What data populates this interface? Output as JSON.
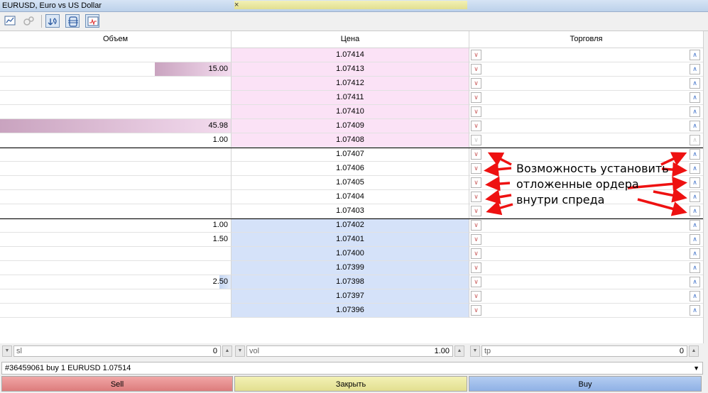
{
  "window": {
    "title": "EURUSD, Euro vs US Dollar",
    "close_glyph": "×"
  },
  "toolbar": {
    "buttons": [
      "chart-icon",
      "disabled-trade-icon",
      "scroll-to-price-icon",
      "center-spread-icon",
      "tick-chart-icon"
    ]
  },
  "columns": {
    "volume": "Объем",
    "price": "Цена",
    "trade": "Торговля"
  },
  "colors": {
    "ask_bg": "#fbe2f6",
    "bid_bg": "#d5e2f9",
    "ask_bar": "#c9a3bf",
    "bid_bar": "#c3d5f2",
    "sell": "#e28b8b",
    "close": "#e9e6a3",
    "buy": "#9fbdea",
    "arrow": "#ee1111"
  },
  "rows": [
    {
      "price": "1.07414",
      "volume": "",
      "side": "ask",
      "bar": 0
    },
    {
      "price": "1.07413",
      "volume": "15.00",
      "side": "ask",
      "bar": 0.33
    },
    {
      "price": "1.07412",
      "volume": "",
      "side": "ask",
      "bar": 0
    },
    {
      "price": "1.07411",
      "volume": "",
      "side": "ask",
      "bar": 0
    },
    {
      "price": "1.07410",
      "volume": "",
      "side": "ask",
      "bar": 0
    },
    {
      "price": "1.07409",
      "volume": "45.98",
      "side": "ask",
      "bar": 1
    },
    {
      "price": "1.07408",
      "volume": "1.00",
      "side": "ask",
      "bar": 0
    },
    {
      "price": "1.07407",
      "volume": "",
      "side": "spread",
      "bar": 0
    },
    {
      "price": "1.07406",
      "volume": "",
      "side": "spread",
      "bar": 0
    },
    {
      "price": "1.07405",
      "volume": "",
      "side": "spread",
      "bar": 0
    },
    {
      "price": "1.07404",
      "volume": "",
      "side": "spread",
      "bar": 0
    },
    {
      "price": "1.07403",
      "volume": "",
      "side": "spread",
      "bar": 0
    },
    {
      "price": "1.07402",
      "volume": "1.00",
      "side": "bid",
      "bar": 0
    },
    {
      "price": "1.07401",
      "volume": "1.50",
      "side": "bid",
      "bar": 0
    },
    {
      "price": "1.07400",
      "volume": "",
      "side": "bid",
      "bar": 0
    },
    {
      "price": "1.07399",
      "volume": "",
      "side": "bid",
      "bar": 0
    },
    {
      "price": "1.07398",
      "volume": "2.50",
      "side": "bid",
      "bar": 0.05
    },
    {
      "price": "1.07397",
      "volume": "",
      "side": "bid",
      "bar": 0
    },
    {
      "price": "1.07396",
      "volume": "",
      "side": "bid",
      "bar": 0
    }
  ],
  "annotation": {
    "line1": "Возможность установить",
    "line2": "отложенные ордера",
    "line3": "внутри спреда"
  },
  "inputs": {
    "sl": {
      "label": "sl",
      "value": "0"
    },
    "vol": {
      "label": "vol",
      "value": "1.00"
    },
    "tp": {
      "label": "tp",
      "value": "0"
    }
  },
  "position_combo": "#36459061 buy 1 EURUSD 1.07514",
  "actions": {
    "sell": "Sell",
    "close": "Закрыть",
    "buy": "Buy"
  }
}
